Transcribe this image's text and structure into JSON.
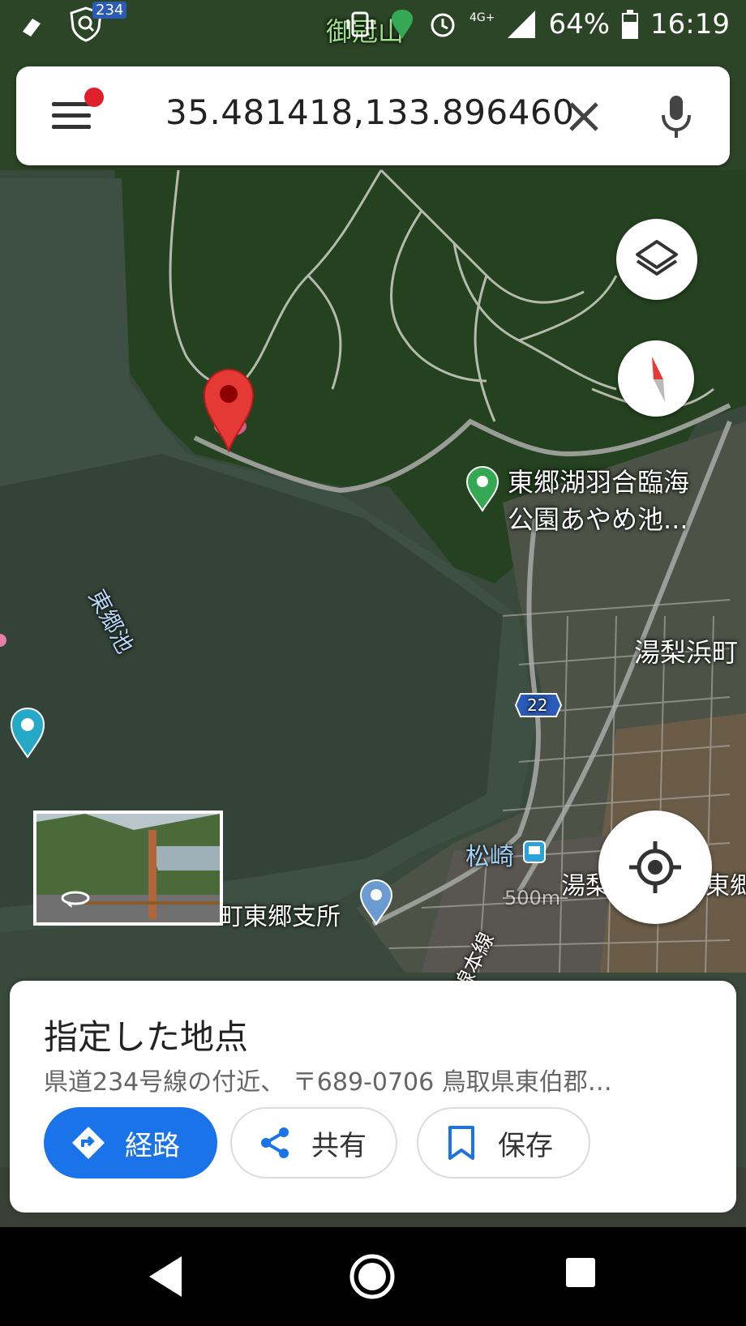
{
  "status_bar": {
    "route_number": "234",
    "peak_name": "御冠山",
    "network": "4G+",
    "battery": "64%",
    "time": "16:19"
  },
  "search": {
    "query": "35.481418,133.896460",
    "menu_icon": "menu-icon",
    "clear_icon": "close-icon",
    "voice_icon": "mic-icon"
  },
  "map": {
    "labels": {
      "poi_park_line1": "東郷湖羽合臨海",
      "poi_park_line2": "公園あやめ池...",
      "lake_name": "東郷池",
      "town_east": "湯梨浜町",
      "route_shield": "22",
      "station": "松崎",
      "town_cut1": "湯梨",
      "town_cut2": "東郷",
      "branch_office_prefix": "町",
      "branch_office": "東郷支所",
      "scale": "500m",
      "rail_line": "線本線"
    }
  },
  "place": {
    "title": "指定した地点",
    "address": "県道234号線の付近、 〒689-0706 鳥取県東伯郡…",
    "actions": {
      "directions": "経路",
      "share": "共有",
      "save": "保存"
    }
  },
  "colors": {
    "accent": "#1a73e8",
    "pin": "#e53935",
    "badge": "#e0202a"
  }
}
